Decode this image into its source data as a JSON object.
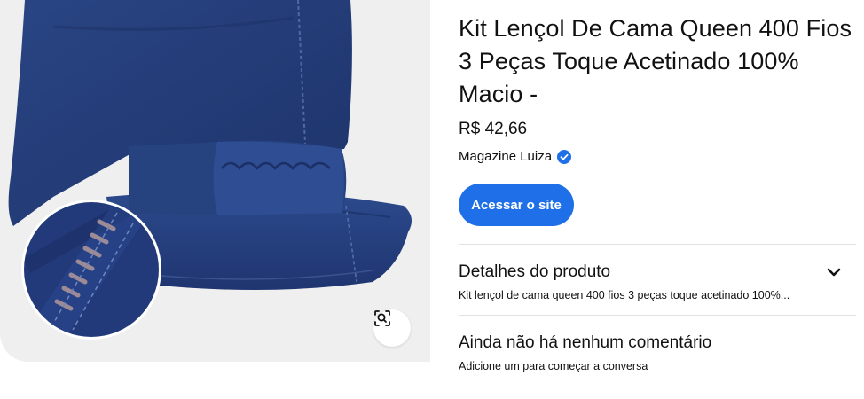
{
  "product": {
    "title": "Kit Lençol De Cama Queen 400 Fios 3 Peças Toque Acetinado 100% Macio -",
    "price": "R$ 42,66",
    "seller": "Magazine Luiza",
    "visit_button": "Acessar o site"
  },
  "details": {
    "heading": "Detalhes do produto",
    "summary": "Kit lençol de cama queen 400 fios 3 peças toque acetinado 100%..."
  },
  "comments": {
    "heading": "Ainda não há nenhum comentário",
    "prompt": "Adicione um para começar a conversa"
  },
  "icons": {
    "verified": "verified-badge-icon",
    "expand": "chevron-down-icon",
    "visual_search": "visual-search-icon"
  },
  "colors": {
    "accent": "#1e6fe8",
    "fabric": "#243d78"
  }
}
